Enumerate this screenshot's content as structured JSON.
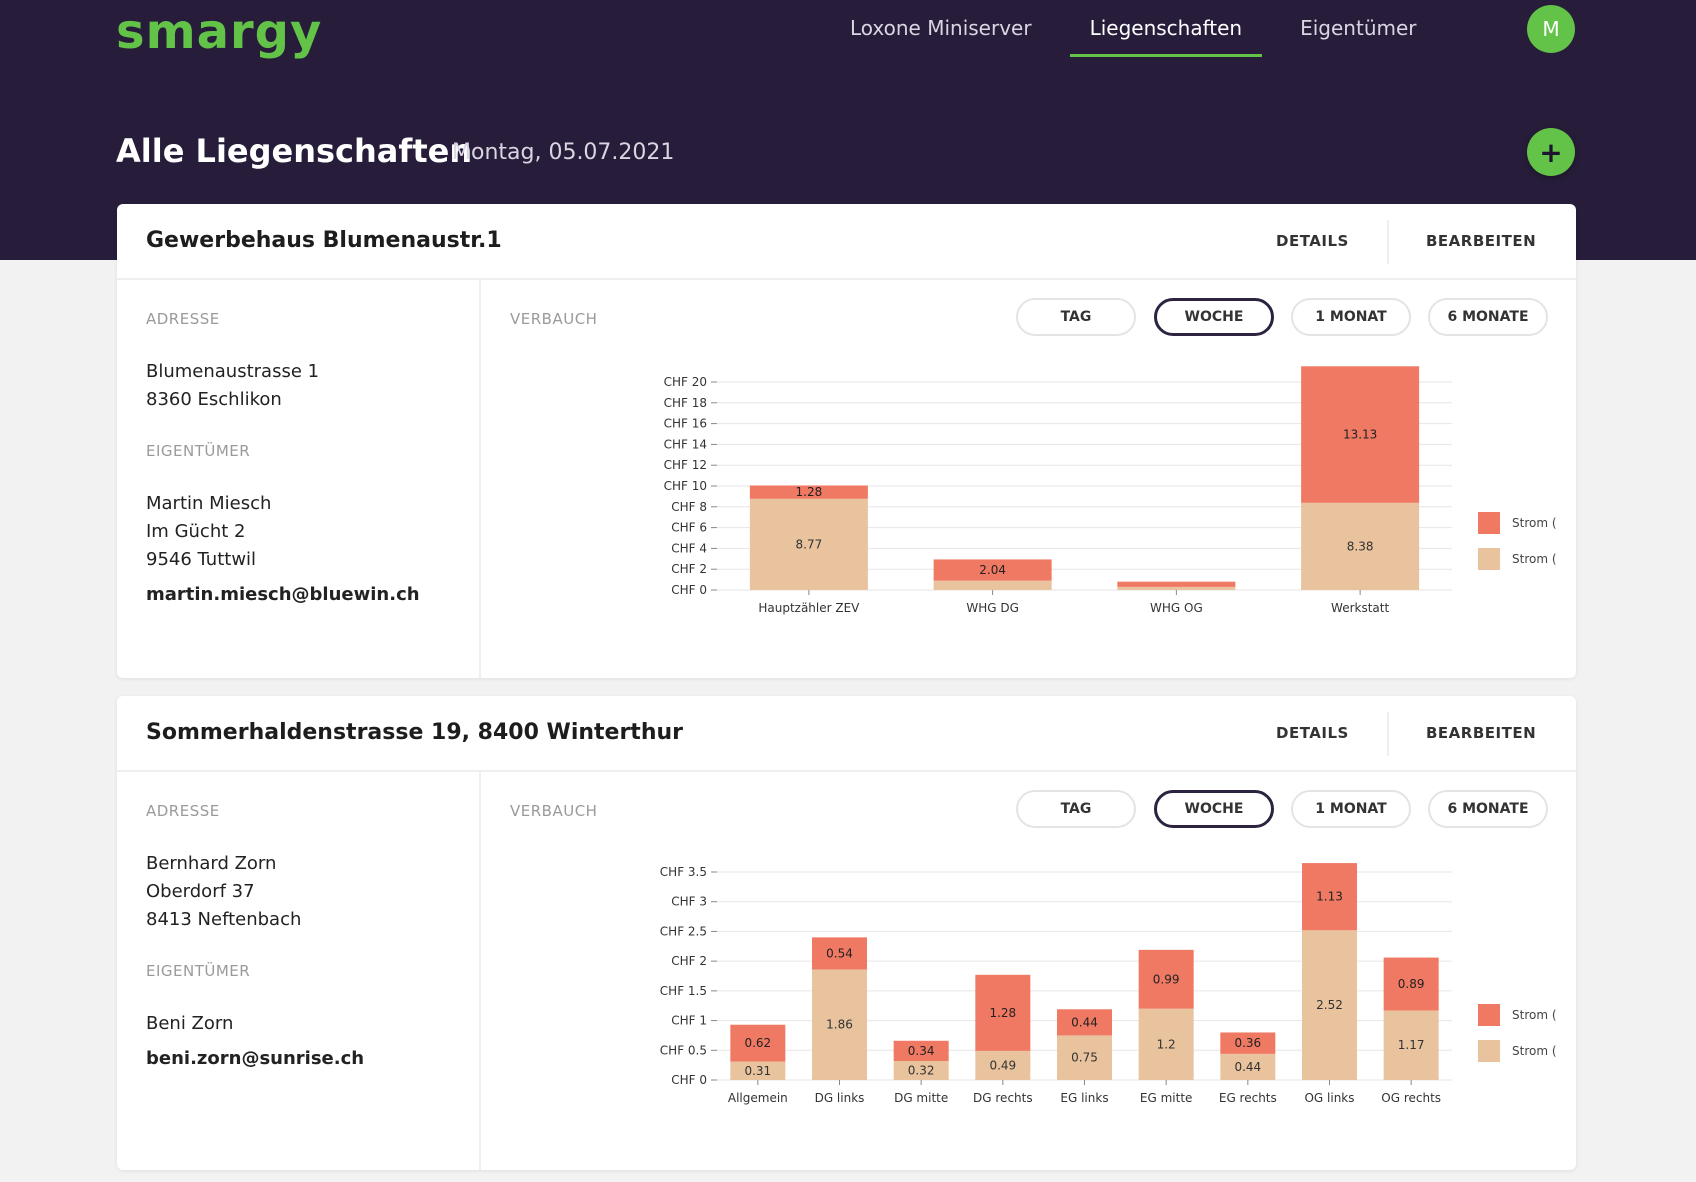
{
  "app": {
    "logo": "smargy"
  },
  "nav": {
    "items": [
      {
        "label": "Loxone Miniserver",
        "active": false
      },
      {
        "label": "Liegenschaften",
        "active": true
      },
      {
        "label": "Eigentümer",
        "active": false
      }
    ],
    "avatar_initial": "M"
  },
  "page": {
    "title": "Alle Liegenschaften",
    "date": "Montag, 05.07.2021",
    "add_button": "+"
  },
  "colors": {
    "header": "#271d3a",
    "accent": "#63c248",
    "strom_n": "#f07963",
    "strom_h": "#e8c39d"
  },
  "cards": [
    {
      "title": "Gewerbehaus Blumenaustr.1",
      "details": "DETAILS",
      "edit": "BEARBEITEN",
      "address_label": "ADRESSE",
      "address_lines": [
        "Blumenaustrasse 1",
        "8360 Eschlikon"
      ],
      "owner_label": "EIGENTÜMER",
      "owner_lines": [
        "Martin Miesch",
        "Im Gücht 2",
        "9546 Tuttwil"
      ],
      "email": "martin.miesch@bluewin.ch",
      "usage_label": "VERBAUCH",
      "ranges": [
        "TAG",
        "WOCHE",
        "1 MONAT",
        "6 MONATE"
      ],
      "active_range": 1
    },
    {
      "title": "Sommerhaldenstrasse 19, 8400 Winterthur",
      "details": "DETAILS",
      "edit": "BEARBEITEN",
      "address_label": "ADRESSE",
      "address_lines": [
        "Bernhard Zorn",
        "Oberdorf 37",
        "8413 Neftenbach"
      ],
      "owner_label": "EIGENTÜMER",
      "owner_lines": [
        "Beni Zorn"
      ],
      "email": "beni.zorn@sunrise.ch",
      "usage_label": "VERBAUCH",
      "ranges": [
        "TAG",
        "WOCHE",
        "1 MONAT",
        "6 MONATE"
      ],
      "active_range": 1
    }
  ],
  "chart_data": [
    {
      "type": "bar",
      "stacked": true,
      "categories": [
        "Hauptzähler ZEV",
        "WHG DG",
        "WHG OG",
        "Werkstatt"
      ],
      "series": [
        {
          "name": "Strom (H)",
          "values": [
            8.77,
            0.9,
            0.3,
            8.38
          ],
          "labels": [
            "8.77",
            "",
            "",
            "8.38"
          ]
        },
        {
          "name": "Strom (N)",
          "values": [
            1.28,
            2.04,
            0.5,
            13.13
          ],
          "labels": [
            "1.28",
            "2.04",
            "",
            "13.13"
          ]
        }
      ],
      "ylim": [
        0,
        20
      ],
      "yticks": [
        0,
        2,
        4,
        6,
        8,
        10,
        12,
        14,
        16,
        18,
        20
      ],
      "ytick_labels": [
        "CHF 0",
        "CHF 2",
        "CHF 4",
        "CHF 6",
        "CHF 8",
        "CHF 10",
        "CHF 12",
        "CHF 14",
        "CHF 16",
        "CHF 18",
        "CHF 20"
      ],
      "legend": [
        "Strom (N)",
        "Strom (H)"
      ],
      "legend_position": "right",
      "grid": true
    },
    {
      "type": "bar",
      "stacked": true,
      "categories": [
        "Allgemein",
        "DG links",
        "DG mitte",
        "DG rechts",
        "EG links",
        "EG mitte",
        "EG rechts",
        "OG links",
        "OG rechts"
      ],
      "series": [
        {
          "name": "Strom (H)",
          "values": [
            0.31,
            1.86,
            0.32,
            0.49,
            0.75,
            1.2,
            0.44,
            2.52,
            1.17
          ],
          "labels": [
            "0.31",
            "1.86",
            "0.32",
            "0.49",
            "0.75",
            "1.2",
            "0.44",
            "2.52",
            "1.17"
          ]
        },
        {
          "name": "Strom (N)",
          "values": [
            0.62,
            0.54,
            0.34,
            1.28,
            0.44,
            0.99,
            0.36,
            1.13,
            0.89
          ],
          "labels": [
            "0.62",
            "0.54",
            "0.34",
            "1.28",
            "0.44",
            "0.99",
            "0.36",
            "1.13",
            "0.89"
          ]
        }
      ],
      "ylim": [
        0,
        3.5
      ],
      "yticks": [
        0,
        0.5,
        1,
        1.5,
        2,
        2.5,
        3,
        3.5
      ],
      "ytick_labels": [
        "CHF 0",
        "CHF 0.5",
        "CHF 1",
        "CHF 1.5",
        "CHF 2",
        "CHF 2.5",
        "CHF 3",
        "CHF 3.5"
      ],
      "legend": [
        "Strom (N)",
        "Strom (H)"
      ],
      "legend_position": "right",
      "grid": true
    }
  ]
}
